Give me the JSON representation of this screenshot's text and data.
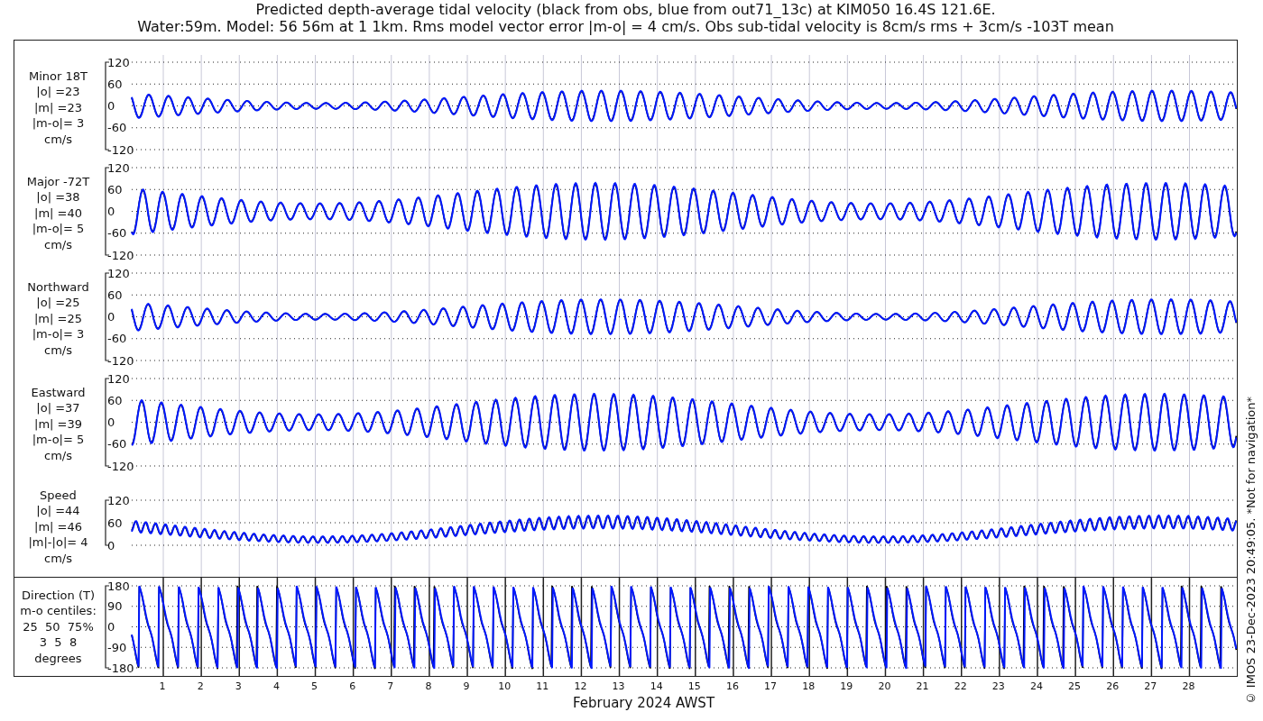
{
  "title": [
    "Predicted depth-average tidal velocity (black from obs, blue from out71_13c) at KIM050 16.4S 121.6E.",
    "Water:59m. Model: 56 56m at 1 1km. Rms model vector error |m-o| = 4 cm/s. Obs sub-tidal velocity is 8cm/s rms + 3cm/s -103T mean"
  ],
  "panels": [
    {
      "kind": "wave",
      "label": [
        "Minor 18T",
        "|o| =23",
        "|m| =23",
        "|m-o|= 3",
        "cm/s"
      ],
      "yticks": [
        "120",
        "60",
        "0",
        "-60",
        "-120"
      ]
    },
    {
      "kind": "wave",
      "label": [
        "Major -72T",
        "|o| =38",
        "|m| =40",
        "|m-o|= 5",
        "cm/s"
      ],
      "yticks": [
        "120",
        "60",
        "0",
        "-60",
        "-120"
      ]
    },
    {
      "kind": "wave",
      "label": [
        "Northward",
        "|o| =25",
        "|m| =25",
        "|m-o|= 3",
        "cm/s"
      ],
      "yticks": [
        "120",
        "60",
        "0",
        "-60",
        "-120"
      ]
    },
    {
      "kind": "wave",
      "label": [
        "Eastward",
        "|o| =37",
        "|m| =39",
        "|m-o|= 5",
        "cm/s"
      ],
      "yticks": [
        "120",
        "60",
        "0",
        "-60",
        "-120"
      ]
    },
    {
      "kind": "speed",
      "label": [
        "Speed",
        "|o| =44",
        "|m| =46",
        "|m|-|o|= 4",
        "cm/s"
      ],
      "yticks": [
        "120",
        "60",
        "0"
      ]
    },
    {
      "kind": "direction",
      "label": [
        "Direction (T)",
        "m-o centiles:",
        "25  50  75%",
        "3  5  8",
        "degrees"
      ],
      "yticks": [
        "180",
        "90",
        "0",
        "-90",
        "-180"
      ]
    }
  ],
  "x_axis": {
    "labels": [
      "1",
      "2",
      "3",
      "4",
      "5",
      "6",
      "7",
      "8",
      "9",
      "10",
      "11",
      "12",
      "13",
      "14",
      "15",
      "16",
      "17",
      "18",
      "19",
      "20",
      "21",
      "22",
      "23",
      "24",
      "25",
      "26",
      "27",
      "28"
    ],
    "title": "February 2024 AWST"
  },
  "credit": "© IMOS 23-Dec-2023 20:49:05. *Not for navigation*"
}
